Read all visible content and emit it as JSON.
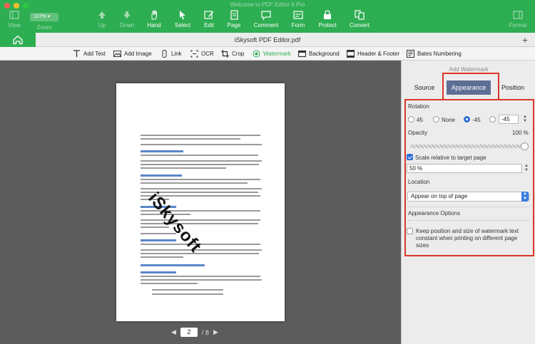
{
  "window": {
    "title": "Welcome to PDF Editor 6 Pro"
  },
  "toolbar": {
    "zoom_value": "107%",
    "zoom_label": "Zoom",
    "buttons": [
      {
        "label": "View",
        "icon": "view-icon"
      },
      {
        "label": "Up",
        "icon": "up-arrow-icon"
      },
      {
        "label": "Down",
        "icon": "down-arrow-icon"
      },
      {
        "label": "Hand",
        "icon": "hand-icon"
      },
      {
        "label": "Select",
        "icon": "cursor-icon"
      },
      {
        "label": "Edit",
        "icon": "edit-icon"
      },
      {
        "label": "Page",
        "icon": "page-icon"
      },
      {
        "label": "Comment",
        "icon": "comment-icon"
      },
      {
        "label": "Form",
        "icon": "form-icon"
      },
      {
        "label": "Protect",
        "icon": "lock-icon"
      },
      {
        "label": "Convert",
        "icon": "convert-icon"
      },
      {
        "label": "Format",
        "icon": "format-icon"
      }
    ]
  },
  "tabs": {
    "document_title": "iSkysoft PDF Editor.pdf",
    "add_tab": "+"
  },
  "edit_tools": [
    {
      "label": "Add Text",
      "icon": "text-icon"
    },
    {
      "label": "Add Image",
      "icon": "image-icon"
    },
    {
      "label": "Link",
      "icon": "link-icon"
    },
    {
      "label": "OCR",
      "icon": "ocr-icon"
    },
    {
      "label": "Crop",
      "icon": "crop-icon"
    },
    {
      "label": "Watermark",
      "icon": "watermark-icon"
    },
    {
      "label": "Background",
      "icon": "background-icon"
    },
    {
      "label": "Header & Footer",
      "icon": "header-footer-icon"
    },
    {
      "label": "Bates Numbering",
      "icon": "bates-icon"
    }
  ],
  "document": {
    "watermark_text": "iSkysoft"
  },
  "pager": {
    "current_page": "2",
    "total": "/ 8"
  },
  "panel": {
    "title": "Add Watermark",
    "tabs": [
      "Source",
      "Appearance",
      "Position"
    ],
    "rotation": {
      "label": "Rotation",
      "options": [
        "45",
        "None",
        "-45"
      ],
      "selected": "-45",
      "custom_value": "-45"
    },
    "opacity": {
      "label": "Opacity",
      "value": "100 %",
      "fraction": 1.0
    },
    "scale": {
      "label": "Scale relative to target page",
      "checked": true,
      "value": "50 %"
    },
    "location": {
      "label": "Location",
      "value": "Appear on top of page"
    },
    "appearance_options": {
      "label": "Appearance Options",
      "keep_label": "Keep position and size of watermark text constant when printing on different page sizes",
      "checked": false
    }
  },
  "colors": {
    "toolbar_green": "#2eae52",
    "highlight_red": "#d9372a",
    "tab_selected": "#5d6f94"
  }
}
